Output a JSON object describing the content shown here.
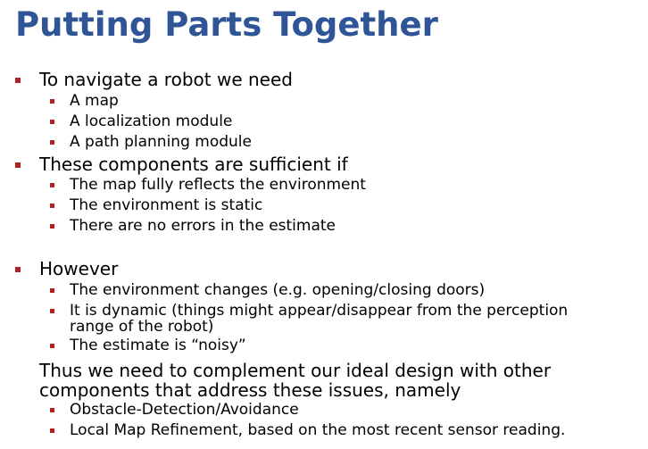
{
  "slide": {
    "title": "Putting Parts Together",
    "accent_color": "#b22222",
    "title_color": "#2f5597",
    "bullets": [
      {
        "text": "To navigate a robot we need",
        "sub": [
          "A map",
          "A localization module",
          "A path planning module"
        ]
      },
      {
        "text": "These components are sufficient if",
        "sub": [
          "The map fully reflects the  environment",
          "The environment is static",
          "There are no errors in the estimate"
        ]
      },
      {
        "text": "However",
        "sub": [
          "The environment changes (e.g. opening/closing doors)",
          "It is dynamic (things might appear/disappear from the perception",
          "range of the robot)",
          "The estimate is “noisy”"
        ]
      }
    ],
    "conclusion": {
      "line1": "Thus we need to complement our ideal design with other",
      "line2": "components that address these issues, namely",
      "sub": [
        "Obstacle-Detection/Avoidance",
        "Local Map Refinement, based on the most recent sensor reading."
      ]
    }
  }
}
